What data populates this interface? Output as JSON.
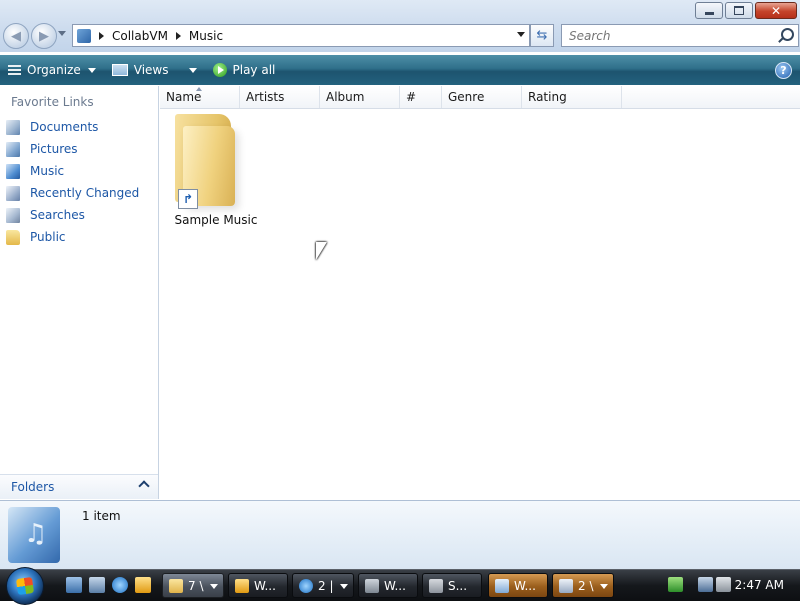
{
  "address": {
    "crumbs": [
      "CollabVM",
      "Music"
    ]
  },
  "search": {
    "placeholder": "Search"
  },
  "toolbar": {
    "organize": "Organize",
    "views": "Views",
    "play_all": "Play all",
    "help": "?"
  },
  "nav": {
    "heading": "Favorite Links",
    "items": [
      {
        "label": "Documents",
        "icon": "documents-icon"
      },
      {
        "label": "Pictures",
        "icon": "pictures-icon"
      },
      {
        "label": "Music",
        "icon": "music-icon"
      },
      {
        "label": "Recently Changed",
        "icon": "recently-changed-icon"
      },
      {
        "label": "Searches",
        "icon": "searches-icon"
      },
      {
        "label": "Public",
        "icon": "public-folder-icon"
      }
    ],
    "folders_label": "Folders"
  },
  "columns": [
    "Name",
    "Artists",
    "Album",
    "#",
    "Genre",
    "Rating"
  ],
  "files": [
    {
      "name": "Sample Music",
      "icon": "folder-shortcut-icon"
    }
  ],
  "details": {
    "count": "1 item"
  },
  "taskbar": {
    "tasks": [
      {
        "label": "7 \\"
      },
      {
        "label": "W..."
      },
      {
        "label": "2 |"
      },
      {
        "label": "W..."
      },
      {
        "label": "S..."
      },
      {
        "label": "W..."
      },
      {
        "label": "2 \\"
      }
    ],
    "clock": "2:47 AM"
  },
  "colors": {
    "toolbar": "#2f6f8a",
    "link": "#1d57a6",
    "taskbar": "#15181c"
  }
}
